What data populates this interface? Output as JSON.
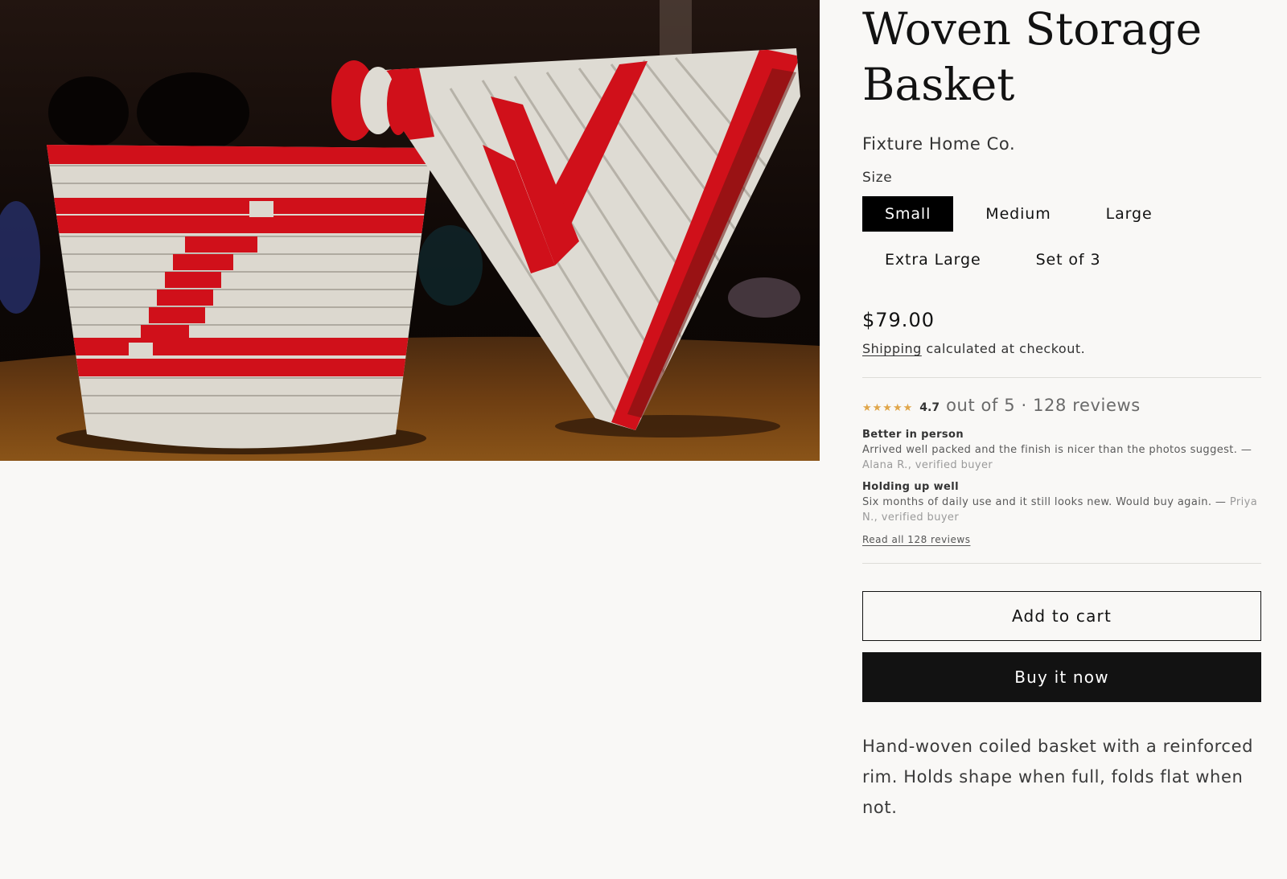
{
  "product": {
    "title": "Woven Storage Basket",
    "vendor": "Fixture Home Co.",
    "size_label": "Size",
    "sizes": [
      "Small",
      "Medium",
      "Large",
      "Extra Large",
      "Set of 3"
    ],
    "selected_size": "Small",
    "price": "$79.00",
    "shipping_link": "Shipping",
    "shipping_suffix": " calculated at checkout.",
    "description": "Hand-woven coiled basket with a reinforced rim. Holds shape when full, folds flat when not."
  },
  "rating": {
    "stars": "★★★★★",
    "score": "4.7",
    "summary": "out of 5 · 128 reviews",
    "reviews": [
      {
        "title": "Better in person",
        "body": "Arrived well packed and the finish is nicer than the photos suggest. — ",
        "author": "Alana R., verified buyer"
      },
      {
        "title": "Holding up well",
        "body": "Six months of daily use and it still looks new. Would buy again. — ",
        "author": "Priya N., verified buyer"
      }
    ],
    "read_all": "Read all 128 reviews"
  },
  "actions": {
    "add_to_cart": "Add to cart",
    "buy_now": "Buy it now"
  },
  "colors": {
    "accent": "#121212",
    "star": "#e0a64a",
    "background": "#f9f8f6",
    "basket_red": "#d0101a",
    "basket_cream": "#e7e4dc"
  }
}
